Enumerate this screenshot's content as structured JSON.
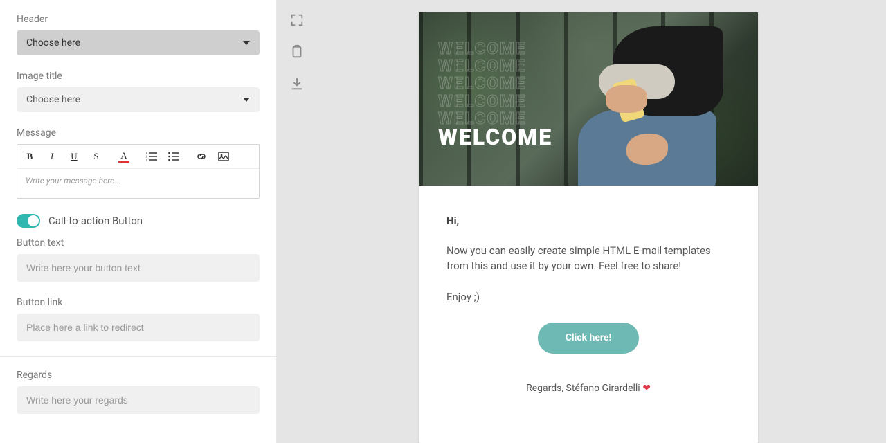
{
  "sidebar": {
    "header": {
      "label": "Header",
      "placeholder": "Choose here"
    },
    "imageTitle": {
      "label": "Image title",
      "placeholder": "Choose here"
    },
    "message": {
      "label": "Message",
      "placeholder": "Write your message here..."
    },
    "cta": {
      "toggleLabel": "Call-to-action Button",
      "enabled": true
    },
    "buttonText": {
      "label": "Button text",
      "placeholder": "Write here your button text"
    },
    "buttonLink": {
      "label": "Button link",
      "placeholder": "Place here a link to redirect"
    },
    "regards": {
      "label": "Regards",
      "placeholder": "Write here your regards"
    },
    "rteButtons": {
      "bold": "B",
      "italic": "I",
      "underline": "U",
      "strike": "S",
      "color": "A"
    }
  },
  "preview": {
    "heroStack": [
      "WELCOME",
      "WELCOME",
      "WELCOME",
      "WELCOME",
      "WELCOME"
    ],
    "heroSolid": "WELCOME",
    "greeting": "Hi,",
    "message1": "Now you can easily create simple HTML E-mail templates from this and use it by your own. Feel free to share!",
    "message2": "Enjoy ;)",
    "ctaLabel": "Click here!",
    "regards": "Regards, Stéfano Girardelli",
    "heart": "❤"
  }
}
